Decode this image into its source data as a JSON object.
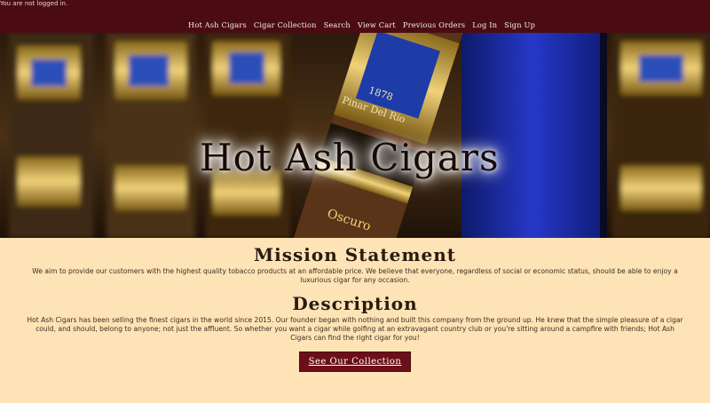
{
  "login_status": "You are not logged in.",
  "nav": {
    "items": [
      "Hot Ash Cigars",
      "Cigar Collection",
      "Search",
      "View Cart",
      "Previous Orders",
      "Log In",
      "Sign Up"
    ]
  },
  "hero": {
    "title": "Hot Ash Cigars",
    "band_brand": "Pinar Del Rio",
    "band_year": "1878",
    "band_label": "Oscuro"
  },
  "mission": {
    "heading": "Mission Statement",
    "text": "We aim to provide our customers with the highest quality tobacco products at an affordable price. We believe that everyone, regardless of social or economic status, should be able to enjoy a luxurious cigar for any occasion."
  },
  "description": {
    "heading": "Description",
    "text": "Hot Ash Cigars has been selling the finest cigars in the world since 2015. Our founder began with nothing and built this company from the ground up. He knew that the simple pleasure of a cigar could, and should, belong to anyone; not just the affluent. So whether you want a cigar while golfing at an extravagant country club or you're sitting around a campfire with friends; Hot Ash Cigars can find the right cigar for you!"
  },
  "cta": {
    "label": "See Our Collection"
  },
  "colors": {
    "nav_background": "#4a0c12",
    "page_background": "#fde3b6",
    "button_background": "#6b0f18"
  }
}
